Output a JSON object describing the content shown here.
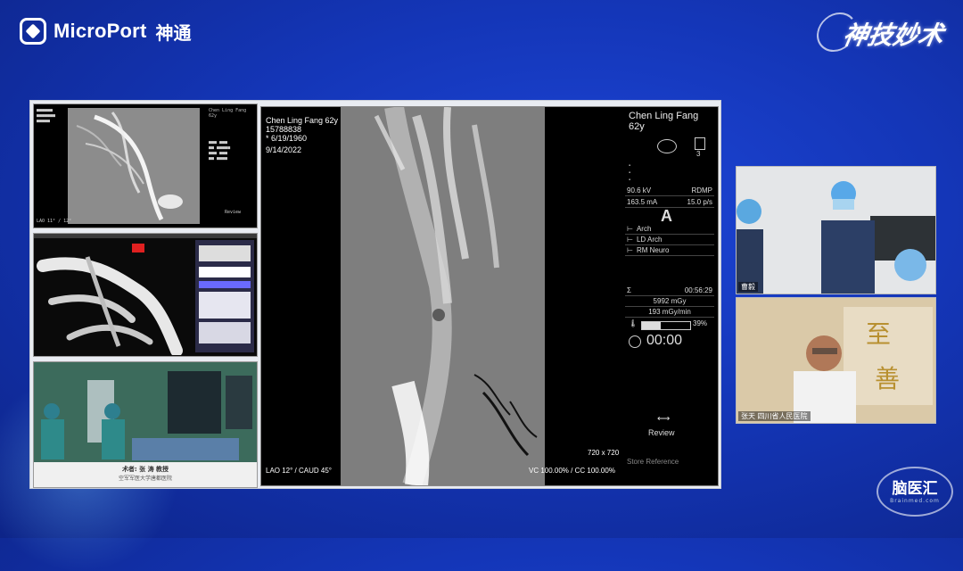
{
  "header": {
    "brand_name": "MicroPort",
    "brand_cn": "神通",
    "slogan": "神技妙术"
  },
  "thumb1": {
    "patient": "Chen Ling Fang\n62y",
    "angle": "LAO 11° / 12°",
    "button": "Review"
  },
  "thumb3": {
    "surgeon": "术者: 张 涛 教授",
    "hospital": "空军军医大学唐都医院"
  },
  "viewer": {
    "patient_name": "Chen Ling Fang 62y",
    "patient_id": "15788838",
    "dob": "* 6/19/1960",
    "exam_date": "9/14/2022",
    "angle": "LAO 12° / CAUD 45°",
    "matrix": "720 x 720",
    "vc_cc": "VC 100.00% / CC 100.00%",
    "right_name": "Chen Ling Fang",
    "right_age": "62y",
    "eye_number": "3",
    "kv": "90.6 kV",
    "mode": "RDMP",
    "ma": "163.5 mA",
    "fps": "15.0 p/s",
    "plane": "A",
    "protocol1": "Arch",
    "protocol2": "LD Arch",
    "protocol3": "RM Neuro",
    "time": "00:56:29",
    "dose": "5992 mGy",
    "dose_rate": "193 mGy/min",
    "heat_pct": "39%",
    "heat_fraction": 0.39,
    "timer": "00:00",
    "review": "Review",
    "store": "Store Reference"
  },
  "cam1": {
    "label": "曹毅"
  },
  "cam2": {
    "label": "张天 四川省人民医院"
  },
  "watermark": {
    "cn": "脑医汇",
    "en": "Brainmed.com"
  }
}
